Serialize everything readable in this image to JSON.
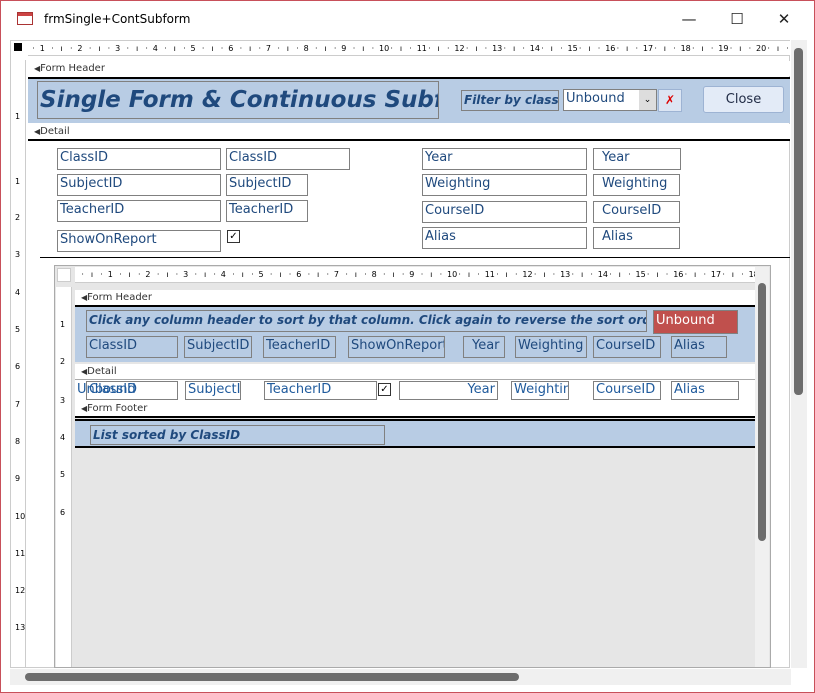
{
  "window": {
    "title": "frmSingle+ContSubform",
    "minimize": "—",
    "maximize": "☐",
    "close": "✕"
  },
  "ruler": {
    "top": [
      "1",
      "2",
      "3",
      "4",
      "5",
      "6",
      "7",
      "8",
      "9",
      "10",
      "11",
      "12",
      "13",
      "14",
      "15",
      "16",
      "17",
      "18",
      "19",
      "20"
    ],
    "left": [
      "1",
      "1",
      "2",
      "3",
      "4",
      "5",
      "6",
      "7",
      "8",
      "9",
      "10",
      "11",
      "12",
      "13"
    ],
    "sub_top": [
      "1",
      "2",
      "3",
      "4",
      "5",
      "6",
      "7",
      "8",
      "9",
      "10",
      "11",
      "12",
      "13",
      "14",
      "15",
      "16",
      "17",
      "18"
    ],
    "sub_left": [
      "1",
      "2",
      "3",
      "4",
      "5",
      "6"
    ]
  },
  "main": {
    "sections": {
      "header": "Form Header",
      "detail": "Detail"
    },
    "header": {
      "title": "Single Form & Continuous Subform",
      "filter_label": "Filter by class",
      "combo_value": "Unbound",
      "close_label": "Close"
    },
    "detail": {
      "labels": [
        "ClassID",
        "SubjectID",
        "TeacherID",
        "ShowOnReport",
        "Year",
        "Weighting",
        "CourseID",
        "Alias"
      ],
      "fields": [
        "ClassID",
        "SubjectID",
        "TeacherID",
        "Year",
        "Weighting",
        "CourseID",
        "Alias"
      ],
      "checkbox": "✓"
    }
  },
  "subform": {
    "sections": {
      "header": "Form Header",
      "detail": "Detail",
      "footer": "Form Footer"
    },
    "instruction": "Click any column header to sort by that column.    Click again to reverse the sort order",
    "unbound": "Unbound",
    "columns": [
      "ClassID",
      "SubjectID",
      "TeacherID",
      "ShowOnReport",
      "Year",
      "Weighting",
      "CourseID",
      "Alias"
    ],
    "detail_fields": [
      "Unbound",
      "ClassID",
      "SubjectII",
      "TeacherID",
      "Year",
      "Weightin",
      "CourseID",
      "Alias"
    ],
    "checkbox": "✓",
    "footer_label": "List sorted by ClassID"
  },
  "colors": {
    "section": "#b8cce4",
    "text": "#1f497d",
    "unbound_bg": "#c0504d"
  }
}
